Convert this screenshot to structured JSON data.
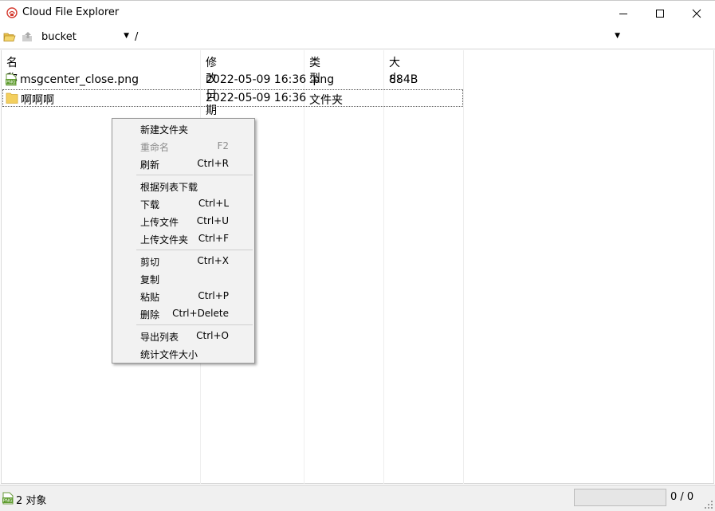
{
  "window": {
    "title": "Cloud File Explorer",
    "minimize_icon": "minimize-icon",
    "maximize_icon": "maximize-icon",
    "close_icon": "close-icon",
    "app_icon": "cloud-drive-icon",
    "accent_color": "#d43a2f"
  },
  "toolbar": {
    "bucket": "bucket",
    "path": "/",
    "folder_icon": "open-folder-icon",
    "up_icon": "up-arrow-icon"
  },
  "list": {
    "columns": [
      "名称",
      "修改日期",
      "类型",
      "大小"
    ],
    "rows": [
      {
        "name": "msgcenter_close.png",
        "modified": "2022-05-09 16:36",
        "type": ".png",
        "size": "884B",
        "icon": "png-file-icon"
      },
      {
        "name": "啊啊啊",
        "modified": "2022-05-09 16:36",
        "type": "文件夹",
        "size": "",
        "icon": "folder-icon"
      }
    ]
  },
  "context_menu": {
    "items": [
      {
        "label": "新建文件夹",
        "shortcut": "",
        "disabled": false
      },
      {
        "label": "重命名",
        "shortcut": "F2",
        "disabled": true
      },
      {
        "label": "刷新",
        "shortcut": "Ctrl+R",
        "disabled": false
      },
      {
        "label": "根据列表下载",
        "shortcut": "",
        "disabled": false
      },
      {
        "label": "下载",
        "shortcut": "Ctrl+L",
        "disabled": false
      },
      {
        "label": "上传文件",
        "shortcut": "Ctrl+U",
        "disabled": false
      },
      {
        "label": "上传文件夹",
        "shortcut": "Ctrl+F",
        "disabled": false
      },
      {
        "label": "剪切",
        "shortcut": "Ctrl+X",
        "disabled": false
      },
      {
        "label": "复制",
        "shortcut": "",
        "disabled": false
      },
      {
        "label": "粘贴",
        "shortcut": "Ctrl+P",
        "disabled": false
      },
      {
        "label": "删除",
        "shortcut": "Ctrl+Delete",
        "disabled": false
      },
      {
        "label": "导出列表",
        "shortcut": "Ctrl+O",
        "disabled": false
      },
      {
        "label": "统计文件大小",
        "shortcut": "",
        "disabled": false
      }
    ]
  },
  "status": {
    "text": "2 对象",
    "counter": "0 / 0",
    "progress_fraction": 0,
    "icon": "png-file-icon"
  }
}
